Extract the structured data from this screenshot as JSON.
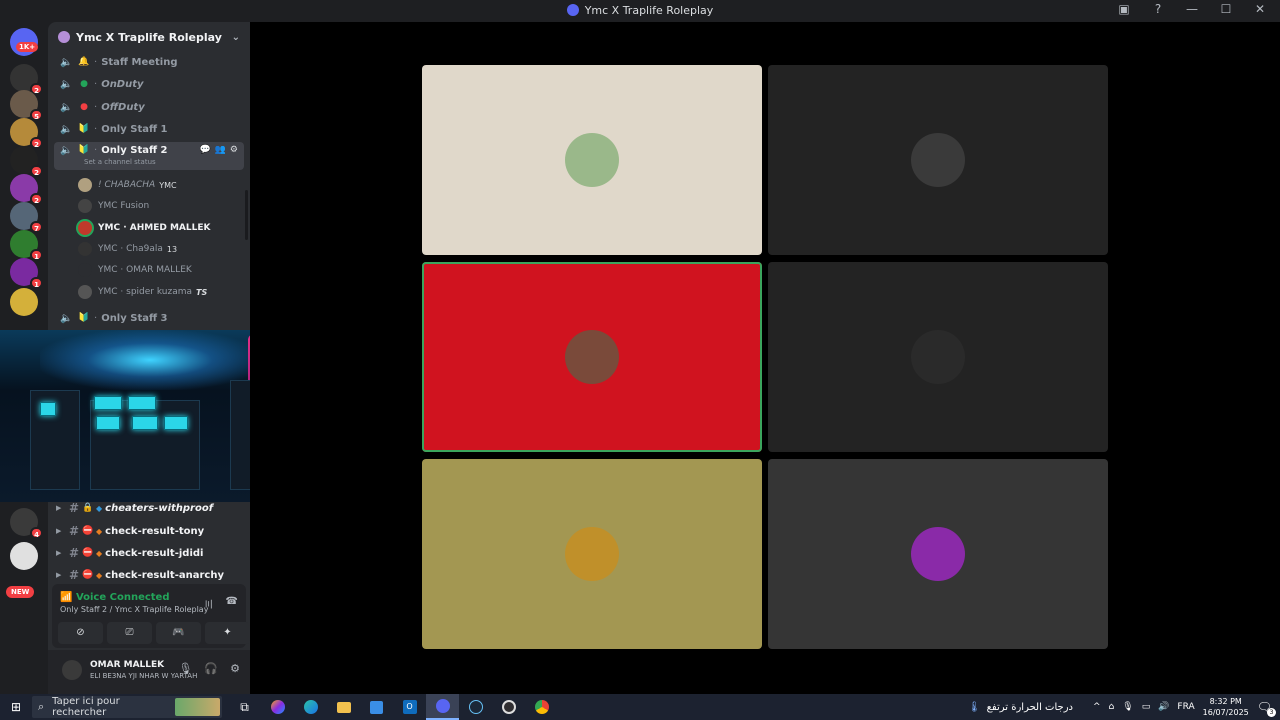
{
  "window": {
    "title": "Ymc X Traplife Roleplay"
  },
  "rail": {
    "home_badge": "1K+",
    "servers": [
      {
        "badge": "2",
        "color": "#333333"
      },
      {
        "badge": "5",
        "color": "#6a5a4a"
      },
      {
        "badge": "2",
        "color": "#b58a3a"
      },
      {
        "badge": "2",
        "color": "#222222"
      },
      {
        "badge": "2",
        "color": "#8a3aa8"
      },
      {
        "badge": "7",
        "color": "#556677"
      },
      {
        "badge": "1",
        "color": "#2f7d2f"
      },
      {
        "badge": "1",
        "color": "#7a2aa0"
      },
      {
        "badge": "",
        "color": "#d4b03a"
      }
    ],
    "lower_servers": [
      {
        "badge": "4",
        "color": "#3a3a3a"
      },
      {
        "badge": "",
        "color": "#e0e0e0"
      }
    ],
    "new_label": "NEW"
  },
  "sidebar": {
    "guild_name": "Ymc X Traplife Roleplay",
    "voice_channels": [
      {
        "emoji": "🔔",
        "name": "Staff Meeting",
        "style": "muted"
      },
      {
        "emoji": "●",
        "name": "OnDuty",
        "style": "italic-green"
      },
      {
        "emoji": "●",
        "name": "OffDuty",
        "style": "italic-red"
      },
      {
        "emoji": "🔰",
        "name": "Only Staff 1",
        "style": "muted"
      }
    ],
    "active_channel": {
      "emoji": "🔰",
      "name": "Only Staff 2",
      "status_placeholder": "Set a channel status"
    },
    "members": [
      {
        "name": "! CHABACHA",
        "tag": "YMC",
        "speaking": false,
        "italic": true
      },
      {
        "name": "YMC  Fusion",
        "tag": "",
        "speaking": false,
        "italic": false
      },
      {
        "name": "YMC · AHMED MALLEK",
        "tag": "",
        "speaking": true,
        "italic": false
      },
      {
        "name": "YMC · Cha9ala",
        "tag": "13",
        "speaking": false,
        "italic": false
      },
      {
        "name": "YMC · OMAR MALLEK",
        "tag": "",
        "speaking": false,
        "italic": false
      },
      {
        "name": "YMC · spider kuzama",
        "tag": "TS",
        "speaking": false,
        "italic": false
      }
    ],
    "next_channel": {
      "emoji": "🔰",
      "name": "Only Staff 3"
    },
    "text_channels": [
      {
        "name": "cheaters-withproof",
        "icon": "lock",
        "italic": true
      },
      {
        "name": "check-result-tony",
        "icon": "no-entry",
        "italic": false
      },
      {
        "name": "check-result-jdidi",
        "icon": "no-entry",
        "italic": false
      },
      {
        "name": "check-result-anarchy",
        "icon": "no-entry",
        "italic": false
      }
    ]
  },
  "voice_panel": {
    "status": "Voice Connected",
    "location": "Only Staff 2 / Ymc X Traplife Roleplay"
  },
  "user_panel": {
    "name": "OMAR MALLEK",
    "status": "ELI BE3NA YJI NHAR W YARTAH"
  },
  "grid": {
    "tiles": [
      {
        "bg": "#e0d8ca",
        "avatar": "#9ab88a",
        "speaking": false
      },
      {
        "bg": "#232323",
        "avatar": "#3a3a3a",
        "speaking": false
      },
      {
        "bg": "#d0131f",
        "avatar": "#7a4a3a",
        "speaking": true
      },
      {
        "bg": "#232323",
        "avatar": "#2a2a2a",
        "speaking": false
      },
      {
        "bg": "#a39752",
        "avatar": "#c0902a",
        "speaking": false
      },
      {
        "bg": "#353535",
        "avatar": "#8a2aa8",
        "speaking": false
      }
    ]
  },
  "taskbar": {
    "search_placeholder": "Taper ici pour rechercher",
    "weather": "درجات الحرارة ترتفع",
    "language": "FRA",
    "time": "8:32 PM",
    "date": "16/07/2025",
    "notifications": "3"
  },
  "colors": {
    "accent": "#5865f2",
    "voice_green": "#23a55a",
    "danger": "#f23f43"
  }
}
